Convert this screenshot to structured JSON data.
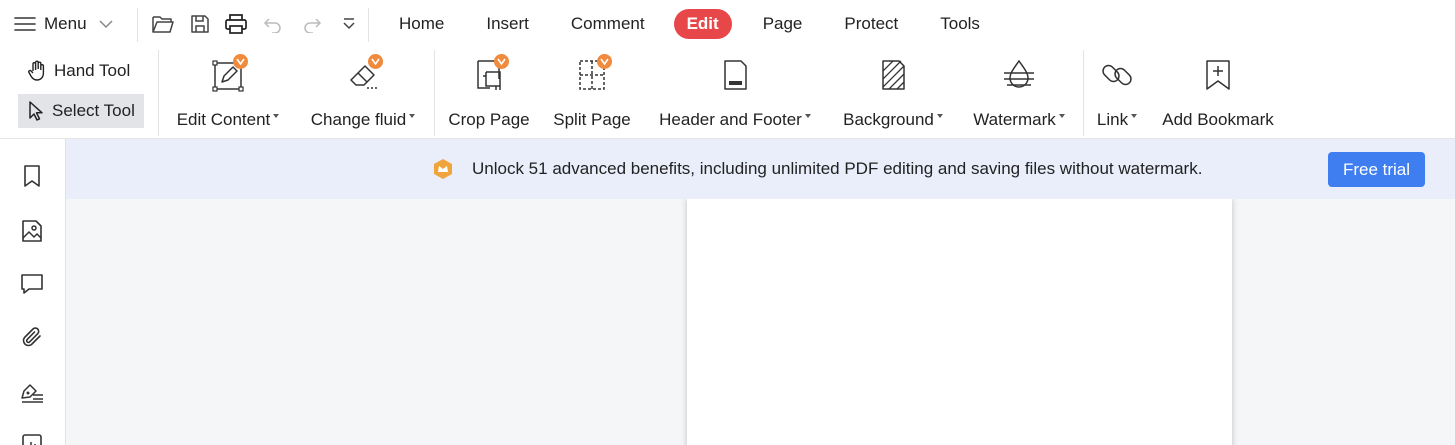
{
  "topbar": {
    "menu_label": "Menu",
    "quick_access": [
      "folder-open-icon",
      "save-icon",
      "print-icon",
      "undo-icon",
      "redo-icon",
      "customize-dropdown-icon"
    ],
    "tabs": [
      {
        "label": "Home",
        "active": false
      },
      {
        "label": "Insert",
        "active": false
      },
      {
        "label": "Comment",
        "active": false
      },
      {
        "label": "Edit",
        "active": true
      },
      {
        "label": "Page",
        "active": false
      },
      {
        "label": "Protect",
        "active": false
      },
      {
        "label": "Tools",
        "active": false
      }
    ]
  },
  "ribbon": {
    "hand_tool": "Hand Tool",
    "select_tool": "Select Tool",
    "edit_content": "Edit Content",
    "change_fluid": "Change fluid",
    "crop_page": "Crop Page",
    "split_page": "Split Page",
    "header_footer": "Header and Footer",
    "background": "Background",
    "watermark": "Watermark",
    "link": "Link",
    "add_bookmark": "Add Bookmark"
  },
  "banner": {
    "text": "Unlock 51 advanced benefits, including unlimited PDF editing and saving files without watermark.",
    "button": "Free trial"
  },
  "sidebar": {
    "icons": [
      "bookmark-icon",
      "image-icon",
      "comment-icon",
      "attachment-icon",
      "signature-icon",
      "form-icon"
    ]
  },
  "colors": {
    "accent_red": "#e8474a",
    "button_blue": "#3e7ef1",
    "banner_bg": "#e9eefa",
    "premium_badge": "#f08a3c"
  }
}
